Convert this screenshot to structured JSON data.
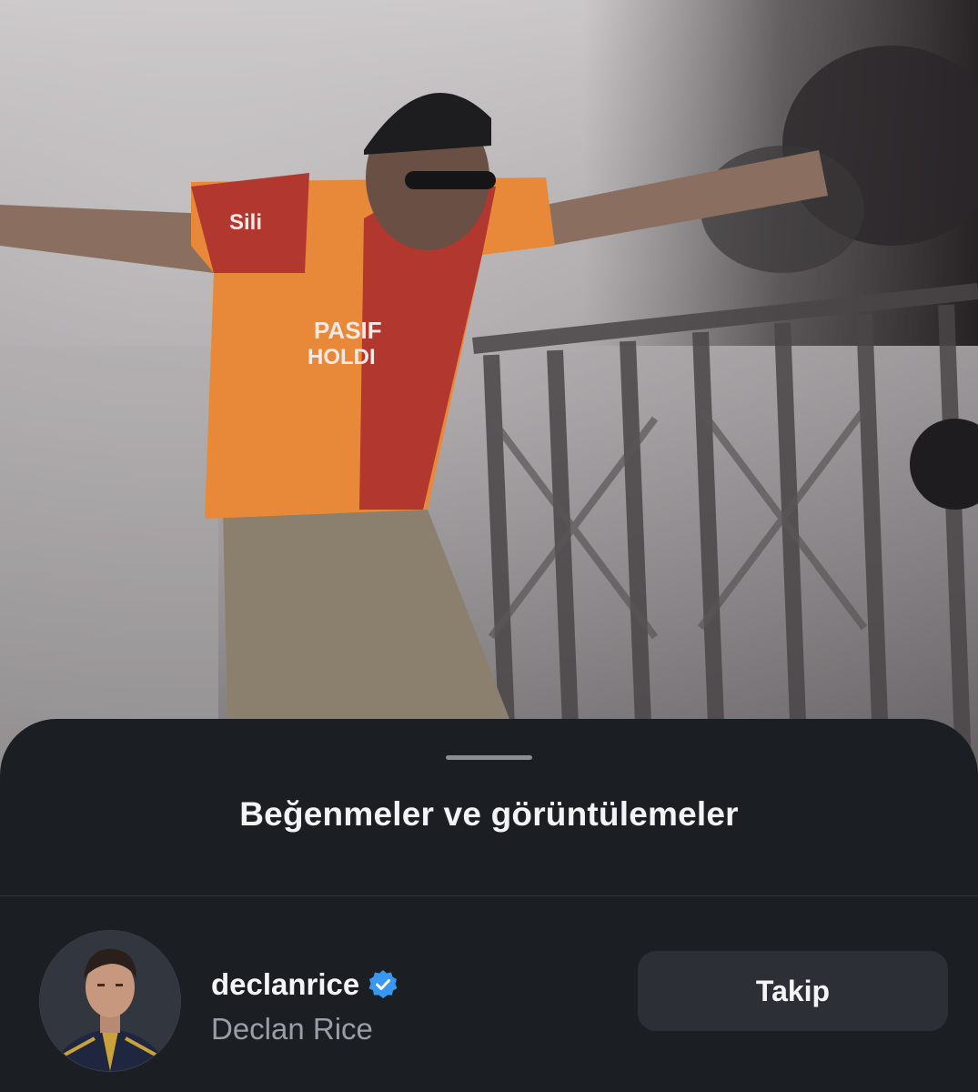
{
  "photo": {
    "description_icon": "concert-photo",
    "jersey_text_line1": "PASIF",
    "jersey_text_line2": "HOLDI",
    "sleeve_text": "Sili"
  },
  "sheet": {
    "title": "Beğenmeler ve görüntülemeler",
    "grabber_icon": "drag-handle"
  },
  "user": {
    "username": "declanrice",
    "full_name": "Declan Rice",
    "verified_icon": "verified-badge-icon",
    "follow_label": "Takip",
    "avatar_icon": "profile-photo"
  },
  "colors": {
    "sheet_background": "#1b1e23",
    "follow_button": "#2c2f35",
    "verified_blue": "#3897f0",
    "secondary_text": "#9a9ea6"
  }
}
